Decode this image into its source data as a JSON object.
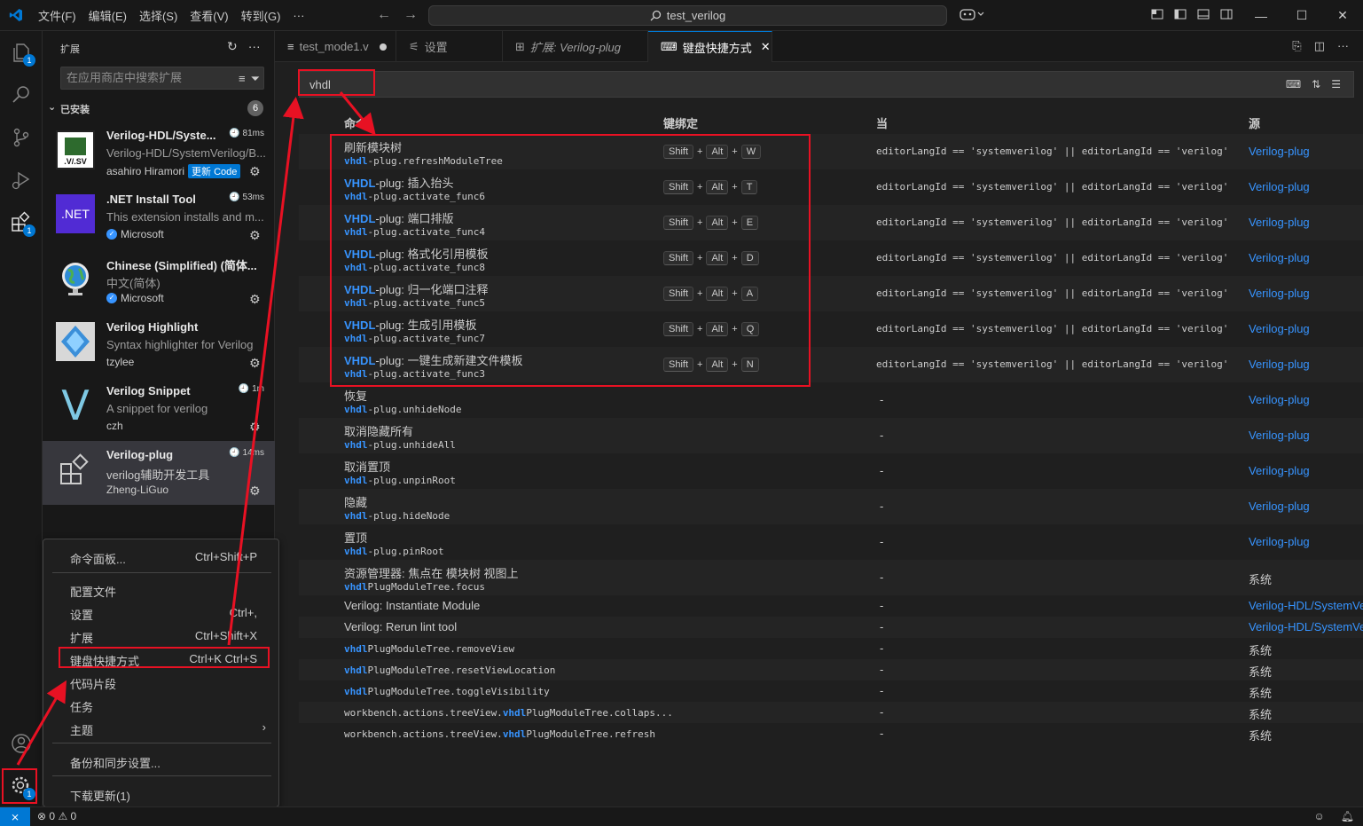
{
  "titlebar": {
    "menu": [
      "文件(F)",
      "编辑(E)",
      "选择(S)",
      "查看(V)",
      "转到(G)",
      "···"
    ],
    "search_text": "test_verilog"
  },
  "activity": {
    "explorer_badge": "1",
    "extensions_badge": "1",
    "manage_badge": "1"
  },
  "sidebar": {
    "title": "扩展",
    "search_placeholder": "在应用商店中搜索扩展",
    "installed_label": "已安装",
    "installed_count": "6",
    "extensions": [
      {
        "name": "Verilog-HDL/Syste...",
        "desc": "Verilog-HDL/SystemVerilog/B...",
        "publisher": "asahiro Hiramori",
        "time": "81ms",
        "tag": "更新 Code",
        "icon_text": ".V/.SV"
      },
      {
        "name": ".NET Install Tool",
        "desc": "This extension installs and m...",
        "publisher": "Microsoft",
        "time": "53ms",
        "icon_text": ".NET"
      },
      {
        "name": "Chinese (Simplified) (简体...",
        "desc": "中文(简体)",
        "publisher": "Microsoft",
        "time": ""
      },
      {
        "name": "Verilog Highlight",
        "desc": "Syntax highlighter for Verilog",
        "publisher": "tzylee",
        "time": ""
      },
      {
        "name": "Verilog Snippet",
        "desc": "A snippet for verilog",
        "publisher": "czh",
        "time": "1m",
        "icon_text": "V"
      },
      {
        "name": "Verilog-plug",
        "desc": "verilog辅助开发工具",
        "publisher": "Zheng-LiGuo",
        "time": "14ms"
      }
    ]
  },
  "tabs": [
    {
      "label": "test_mode1.v",
      "icon": "verilog-file-icon",
      "dirty": true
    },
    {
      "label": "设置",
      "icon": "settings-icon"
    },
    {
      "label": "扩展: Verilog-plug",
      "icon": "extensions-icon"
    },
    {
      "label": "键盘快捷方式",
      "icon": "keyboard-icon",
      "active": true
    }
  ],
  "keybindings": {
    "search_value": "vhdl",
    "columns": {
      "command": "命令",
      "keybinding": "键绑定",
      "when": "当",
      "source": "源"
    },
    "when_common": "editorLangId == 'systemverilog' || editorLangId == 'verilog'",
    "rows": [
      {
        "cmd_pre": "",
        "cmd_hl": "",
        "cmd_post": "刷新模块树",
        "id_hl": "vhdl",
        "id_rest": "-plug.refreshModuleTree",
        "keys": [
          "Shift",
          "Alt",
          "W"
        ],
        "when": "editorLangId == 'systemverilog' || editorLangId == 'verilog'",
        "source": "Verilog-plug"
      },
      {
        "cmd_pre": "",
        "cmd_hl": "VHDL",
        "cmd_post": "-plug: 插入抬头",
        "id_hl": "vhdl",
        "id_rest": "-plug.activate_func6",
        "keys": [
          "Shift",
          "Alt",
          "T"
        ],
        "when": "editorLangId == 'systemverilog' || editorLangId == 'verilog'",
        "source": "Verilog-plug"
      },
      {
        "cmd_pre": "",
        "cmd_hl": "VHDL",
        "cmd_post": "-plug: 端口排版",
        "id_hl": "vhdl",
        "id_rest": "-plug.activate_func4",
        "keys": [
          "Shift",
          "Alt",
          "E"
        ],
        "when": "editorLangId == 'systemverilog' || editorLangId == 'verilog'",
        "source": "Verilog-plug"
      },
      {
        "cmd_pre": "",
        "cmd_hl": "VHDL",
        "cmd_post": "-plug: 格式化引用模板",
        "id_hl": "vhdl",
        "id_rest": "-plug.activate_func8",
        "keys": [
          "Shift",
          "Alt",
          "D"
        ],
        "when": "editorLangId == 'systemverilog' || editorLangId == 'verilog'",
        "source": "Verilog-plug"
      },
      {
        "cmd_pre": "",
        "cmd_hl": "VHDL",
        "cmd_post": "-plug: 归一化端口注释",
        "id_hl": "vhdl",
        "id_rest": "-plug.activate_func5",
        "keys": [
          "Shift",
          "Alt",
          "A"
        ],
        "when": "editorLangId == 'systemverilog' || editorLangId == 'verilog'",
        "source": "Verilog-plug"
      },
      {
        "cmd_pre": "",
        "cmd_hl": "VHDL",
        "cmd_post": "-plug: 生成引用模板",
        "id_hl": "vhdl",
        "id_rest": "-plug.activate_func7",
        "keys": [
          "Shift",
          "Alt",
          "Q"
        ],
        "when": "editorLangId == 'systemverilog' || editorLangId == 'verilog'",
        "source": "Verilog-plug"
      },
      {
        "cmd_pre": "",
        "cmd_hl": "VHDL",
        "cmd_post": "-plug: 一键生成新建文件模板",
        "id_hl": "vhdl",
        "id_rest": "-plug.activate_func3",
        "keys": [
          "Shift",
          "Alt",
          "N"
        ],
        "when": "editorLangId == 'systemverilog' || editorLangId == 'verilog'",
        "source": "Verilog-plug"
      },
      {
        "cmd_pre": "",
        "cmd_hl": "",
        "cmd_post": "恢复",
        "id_hl": "vhdl",
        "id_rest": "-plug.unhideNode",
        "keys": [],
        "when": "-",
        "source": "Verilog-plug"
      },
      {
        "cmd_pre": "",
        "cmd_hl": "",
        "cmd_post": "取消隐藏所有",
        "id_hl": "vhdl",
        "id_rest": "-plug.unhideAll",
        "keys": [],
        "when": "-",
        "source": "Verilog-plug"
      },
      {
        "cmd_pre": "",
        "cmd_hl": "",
        "cmd_post": "取消置顶",
        "id_hl": "vhdl",
        "id_rest": "-plug.unpinRoot",
        "keys": [],
        "when": "-",
        "source": "Verilog-plug"
      },
      {
        "cmd_pre": "",
        "cmd_hl": "",
        "cmd_post": "隐藏",
        "id_hl": "vhdl",
        "id_rest": "-plug.hideNode",
        "keys": [],
        "when": "-",
        "source": "Verilog-plug"
      },
      {
        "cmd_pre": "",
        "cmd_hl": "",
        "cmd_post": "置顶",
        "id_hl": "vhdl",
        "id_rest": "-plug.pinRoot",
        "keys": [],
        "when": "-",
        "source": "Verilog-plug"
      },
      {
        "cmd_pre": "",
        "cmd_hl": "",
        "cmd_post": "资源管理器: 焦点在 模块树 视图上",
        "id_hl": "vhdl",
        "id_rest": "PlugModuleTree.focus",
        "keys": [],
        "when": "-",
        "source": "系统"
      }
    ],
    "short_rows": [
      {
        "pre": "Verilog: Instantiate Module",
        "hl": "",
        "post": "",
        "mono": false,
        "source": "Verilog-HDL/SystemVe",
        "sys": false
      },
      {
        "pre": "Verilog: Rerun lint tool",
        "hl": "",
        "post": "",
        "mono": false,
        "source": "Verilog-HDL/SystemVe",
        "sys": false
      },
      {
        "pre": "",
        "hl": "vhdl",
        "post": "PlugModuleTree.removeView",
        "mono": true,
        "source": "系统",
        "sys": true
      },
      {
        "pre": "",
        "hl": "vhdl",
        "post": "PlugModuleTree.resetViewLocation",
        "mono": true,
        "source": "系统",
        "sys": true
      },
      {
        "pre": "",
        "hl": "vhdl",
        "post": "PlugModuleTree.toggleVisibility",
        "mono": true,
        "source": "系统",
        "sys": true
      },
      {
        "pre": "workbench.actions.treeView.",
        "hl": "vhdl",
        "post": "PlugModuleTree.collaps...",
        "mono": true,
        "source": "系统",
        "sys": true
      },
      {
        "pre": "workbench.actions.treeView.",
        "hl": "vhdl",
        "post": "PlugModuleTree.refresh",
        "mono": true,
        "source": "系统",
        "sys": true
      }
    ]
  },
  "manage_menu": {
    "items": [
      {
        "label": "命令面板...",
        "shortcut": "Ctrl+Shift+P"
      },
      {
        "label": "配置文件",
        "shortcut": ""
      },
      {
        "label": "设置",
        "shortcut": "Ctrl+,"
      },
      {
        "label": "扩展",
        "shortcut": "Ctrl+Shift+X"
      },
      {
        "label": "键盘快捷方式",
        "shortcut": "Ctrl+K Ctrl+S"
      },
      {
        "label": "代码片段",
        "shortcut": ""
      },
      {
        "label": "任务",
        "shortcut": ""
      },
      {
        "label": "主题",
        "shortcut": ""
      },
      {
        "label": "备份和同步设置...",
        "shortcut": ""
      },
      {
        "label": "下载更新(1)",
        "shortcut": ""
      }
    ]
  },
  "statusbar": {
    "errors": "0",
    "warnings": "0"
  },
  "colors": {
    "accent": "#0078d4",
    "link": "#3794ff",
    "annotation": "#e81123"
  }
}
